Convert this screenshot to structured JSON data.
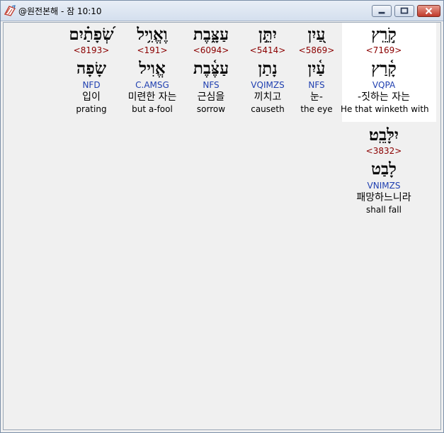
{
  "window": {
    "title": "@원전본해 - 잠 10:10",
    "icon": "bible-book-icon",
    "controls": [
      "minimize",
      "maximize",
      "close"
    ]
  },
  "words": [
    {
      "hebrew": "קֹ֣רֵֽץ",
      "strong": "<7169>",
      "lemma": "קָ֫רַץ",
      "parse": "VQPA",
      "korean": "-짓하는 자는",
      "english": "He that winketh with",
      "selected": true
    },
    {
      "hebrew": "עַ֭יִן",
      "strong": "<5869>",
      "lemma": "עַ֫יִן",
      "parse": "NFS",
      "korean": "눈-",
      "english": "the eye",
      "selected": false
    },
    {
      "hebrew": "יִתֵּ֣ן",
      "strong": "<5414>",
      "lemma": "נָתַן",
      "parse": "VQIMZS",
      "korean": "끼치고",
      "english": "causeth",
      "selected": false
    },
    {
      "hebrew": "עַצָּ֑בֶת",
      "strong": "<6094>",
      "lemma": "עַצֶּ֫בֶת",
      "parse": "NFS",
      "korean": "근심을",
      "english": "sorrow",
      "selected": false
    },
    {
      "hebrew": "וֶאֱוִ֥יל",
      "strong": "<191>",
      "lemma": "אֱוִיל",
      "parse": "C.AMSG",
      "korean": "미련한 자는",
      "english": "but a-fool",
      "selected": false
    },
    {
      "hebrew": "שְׂ֝פָתַ֗יִם",
      "strong": "<8193>",
      "lemma": "שָׂפָה",
      "parse": "NFD",
      "korean": "입이",
      "english": "prating",
      "selected": false
    },
    {
      "hebrew": "יִלָּבֵֽט׃",
      "strong": "<3832>",
      "lemma": "לָבַט",
      "parse": "VNIMZS",
      "korean": "패망하느니라",
      "english": "shall fall",
      "selected": false
    }
  ],
  "colors": {
    "strong": "#8b0000",
    "parse": "#1f3fb0",
    "selected_bg": "#ffffff",
    "client_bg": "#f0f0f0"
  }
}
